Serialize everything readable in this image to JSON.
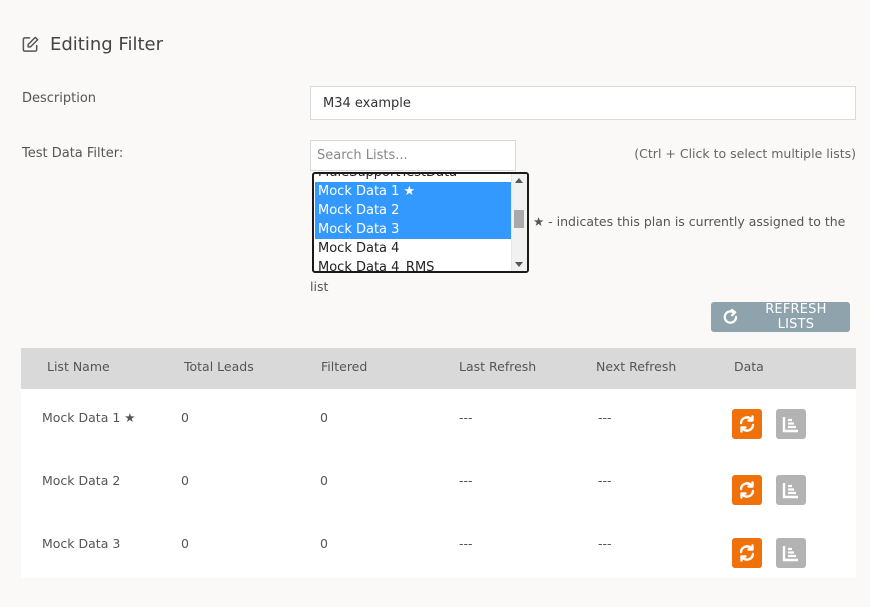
{
  "header": {
    "title": "Editing Filter",
    "icon": "edit-icon"
  },
  "form": {
    "description_label": "Description",
    "description_value": "M34 example",
    "test_data_filter_label": "Test Data Filter:",
    "search_placeholder": "Search Lists...",
    "hint": "(Ctrl + Click to select multiple lists)",
    "list_options": [
      {
        "label": "MuleSupportTestData",
        "selected": false
      },
      {
        "label": "Mock Data 1 ★",
        "selected": true
      },
      {
        "label": "Mock Data 2",
        "selected": true
      },
      {
        "label": "Mock Data 3",
        "selected": true
      },
      {
        "label": "Mock Data 4",
        "selected": false
      },
      {
        "label": "Mock Data 4_RMS",
        "selected": false
      }
    ],
    "star_note": "★ - indicates this plan is currently assigned to the",
    "star_note_cont": "list",
    "refresh_button": "REFRESH LISTS"
  },
  "table": {
    "headers": [
      "List Name",
      "Total Leads",
      "Filtered",
      "Last Refresh",
      "Next Refresh",
      "Data"
    ],
    "rows": [
      {
        "name": "Mock Data 1 ★",
        "total": "0",
        "filtered": "0",
        "last": "---",
        "next": "---"
      },
      {
        "name": "Mock Data 2",
        "total": "0",
        "filtered": "0",
        "last": "---",
        "next": "---"
      },
      {
        "name": "Mock Data 3",
        "total": "0",
        "filtered": "0",
        "last": "---",
        "next": "---"
      }
    ]
  },
  "colors": {
    "selected": "#3399ff",
    "refresh_button": "#8fa3ad",
    "sync_icon_bg": "#f0700a",
    "chart_icon_bg": "#b3b3b3",
    "table_header": "#d9d9d9"
  }
}
